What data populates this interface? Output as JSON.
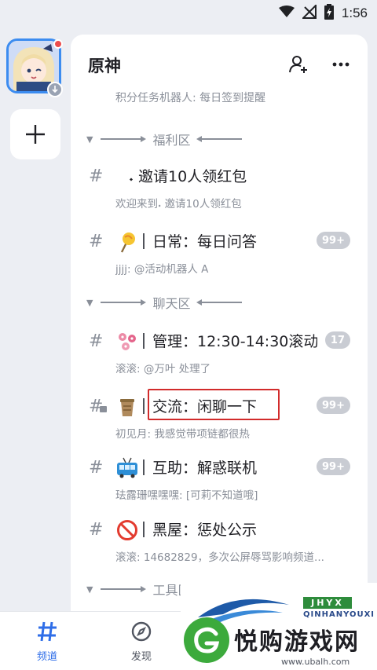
{
  "status_bar": {
    "time": "1:56"
  },
  "server": {
    "name": "原神"
  },
  "top_clipped_preview": "积分任务机器人: 每日签到提醒",
  "categories": [
    {
      "label": "福利区"
    },
    {
      "label": "聊天区"
    },
    {
      "label": "工具区"
    }
  ],
  "channels": [
    {
      "emoji": "",
      "name": "𝆺 邀请10人领红包",
      "preview": "欢迎来到𝆺 邀请10人领红包",
      "badge": ""
    },
    {
      "emoji": "lollipop-icon",
      "name": "日常：每日问答",
      "preview": "jjjj: @活动机器人 A",
      "badge": "99+"
    },
    {
      "emoji": "flowers-icon",
      "name": "管理：12:30-14:30滚动",
      "preview": "滚滚: @万叶 处理了",
      "badge": "17"
    },
    {
      "emoji": "cup-icon",
      "name": "交流：闲聊一下",
      "preview": "初见月: 我感觉带项链都很热",
      "badge": "99+",
      "locked": true,
      "highlighted": true
    },
    {
      "emoji": "trolleybus-icon",
      "name": "互助：解惑联机",
      "preview": "珐露珊嘿嘿嘿: [可莉不知道哦]",
      "badge": "99+"
    },
    {
      "emoji": "prohibited-icon",
      "name": "黑屋：惩处公示",
      "preview": "滚滚: 14682829，多次公屏辱骂影响频道...",
      "badge": ""
    }
  ],
  "bottom_nav": [
    {
      "label": "频道",
      "icon": "hash-icon",
      "active": true
    },
    {
      "label": "发现",
      "icon": "compass-icon",
      "active": false
    }
  ],
  "watermark": {
    "logo_top": "JHYX",
    "logo_sub": "QINHANYOUXI",
    "brand": "悦购游戏网",
    "url": "www.ubalh.com"
  },
  "colors": {
    "accent": "#2f6ee8",
    "badge": "#c9ccd3",
    "highlight": "#d22b2b",
    "muted": "#8a8f99"
  }
}
